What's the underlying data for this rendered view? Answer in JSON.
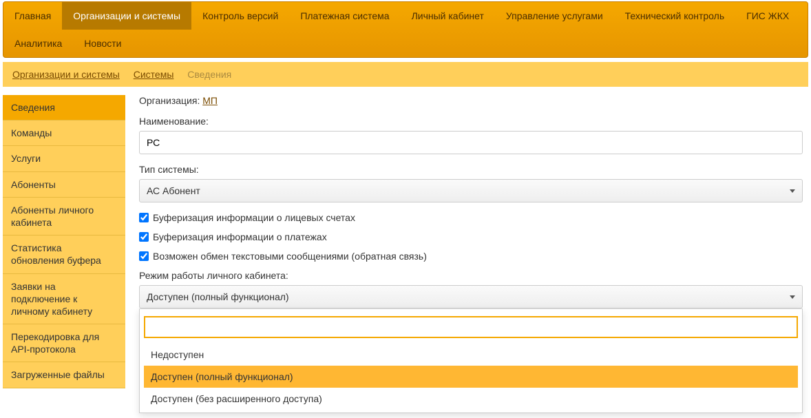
{
  "topnav": {
    "items": [
      {
        "label": "Главная"
      },
      {
        "label": "Организации и системы"
      },
      {
        "label": "Контроль версий"
      },
      {
        "label": "Платежная система"
      },
      {
        "label": "Личный кабинет"
      },
      {
        "label": "Управление услугами"
      },
      {
        "label": "Технический контроль"
      },
      {
        "label": "ГИС ЖКХ"
      },
      {
        "label": "Аналитика"
      },
      {
        "label": "Новости"
      }
    ],
    "active_index": 1
  },
  "breadcrumb": {
    "items": [
      {
        "label": "Организации и системы"
      },
      {
        "label": "Системы"
      },
      {
        "label": "Сведения"
      }
    ]
  },
  "sidebar": {
    "items": [
      {
        "label": "Сведения"
      },
      {
        "label": "Команды"
      },
      {
        "label": "Услуги"
      },
      {
        "label": "Абоненты"
      },
      {
        "label": "Абоненты личного кабинета"
      },
      {
        "label": "Статистика обновления буфера"
      },
      {
        "label": "Заявки на подключение к личному кабинету"
      },
      {
        "label": "Перекодировка для API-протокола"
      },
      {
        "label": "Загруженные файлы"
      }
    ],
    "active_index": 0
  },
  "form": {
    "org_label": "Организация:",
    "org_link": "МП",
    "name_label": "Наименование:",
    "name_value": "РС",
    "type_label": "Тип системы:",
    "type_value": "АС Абонент",
    "chk_buffer_accounts": "Буферизация информации о лицевых счетах",
    "chk_buffer_payments": "Буферизация информации о платежах",
    "chk_text_exchange": "Возможен обмен текстовыми сообщениями (обратная связь)",
    "mode_label": "Режим работы личного кабинета:",
    "mode_value": "Доступен (полный функционал)",
    "mode_options": [
      {
        "label": "Недоступен"
      },
      {
        "label": "Доступен (полный функционал)"
      },
      {
        "label": "Доступен (без расширенного доступа)"
      }
    ],
    "mode_selected_index": 1
  }
}
